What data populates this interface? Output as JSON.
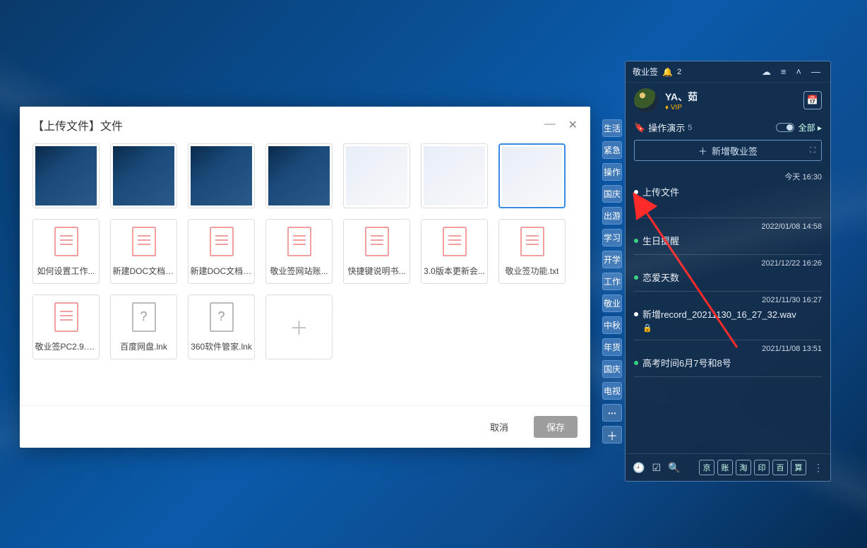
{
  "dialog": {
    "title": "【上传文件】文件",
    "selected_index": 6,
    "images": [
      {
        "kind": "dark"
      },
      {
        "kind": "dark"
      },
      {
        "kind": "dark"
      },
      {
        "kind": "dark"
      },
      {
        "kind": "light"
      },
      {
        "kind": "light"
      },
      {
        "kind": "light"
      }
    ],
    "files": [
      {
        "label": "如何设置工作...",
        "type": "doc"
      },
      {
        "label": "新建DOC文档(...",
        "type": "doc"
      },
      {
        "label": "新建DOC文档(...",
        "type": "doc"
      },
      {
        "label": "敬业签网站账...",
        "type": "doc"
      },
      {
        "label": "快捷键说明书...",
        "type": "doc"
      },
      {
        "label": "3.0版本更新会...",
        "type": "doc"
      },
      {
        "label": "敬业签功能.txt",
        "type": "doc"
      },
      {
        "label": "敬业签PC2.9.0...",
        "type": "doc"
      },
      {
        "label": "百度网盘.lnk",
        "type": "unknown"
      },
      {
        "label": "360软件管家.lnk",
        "type": "unknown"
      }
    ],
    "cancel": "取消",
    "save": "保存"
  },
  "categories": [
    "生活",
    "紧急",
    "操作演示",
    "国庆",
    "出游",
    "学习",
    "开学",
    "工作",
    "敬业",
    "中秋",
    "年货",
    "国庆",
    "电视"
  ],
  "widget": {
    "app_title": "敬业签",
    "bell_count": "2",
    "username": "YA、茹",
    "vip": "VIP",
    "current_cat": "操作演示",
    "current_cat_count": "5",
    "all_label": "全部",
    "add_label": "新增敬业签",
    "notes": [
      {
        "time": "今天 16:30",
        "text": "上传文件",
        "dot": "white",
        "lock": true
      },
      {
        "time": "2022/01/08 14:58",
        "text": "生日提醒",
        "dot": "green",
        "lock": false
      },
      {
        "time": "2021/12/22 16:26",
        "text": "恋爱天数",
        "dot": "green",
        "lock": false
      },
      {
        "time": "2021/11/30 16:27",
        "text": "新增record_20211130_16_27_32.wav",
        "dot": "white",
        "lock": true
      },
      {
        "time": "2021/11/08 13:51",
        "text": "高考时间6月7号和8号",
        "dot": "green",
        "lock": false
      }
    ],
    "footer_squares": [
      "京",
      "账",
      "淘",
      "印",
      "百",
      "算"
    ]
  }
}
